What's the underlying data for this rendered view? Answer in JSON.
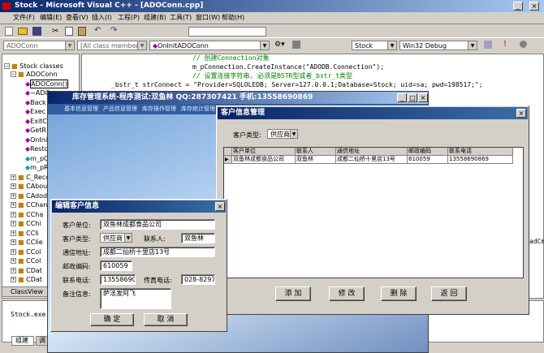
{
  "ide": {
    "title": "Stock - Microsoft Visual C++ - [ADOConn.cpp]",
    "menu": [
      "文件(F)",
      "编辑(E)",
      "查看(V)",
      "插入(I)",
      "工程(P)",
      "组建(B)",
      "工具(T)",
      "窗口(W)",
      "帮助(H)"
    ],
    "class_combo": "ADOConn",
    "members_combo": "[All class members]",
    "method_combo": "OnInitADOConn",
    "project_combo": "Stock",
    "config_combo": "Win32 Debug",
    "tree_root": "Stock classes",
    "tree_items": [
      "ADOConn",
      "ADOConn()",
      "~ADO",
      "Back",
      "Exec",
      "ExitC",
      "GetR",
      "OnIni",
      "Resto",
      "m_pC",
      "m_pR",
      "C_Recor",
      "CAboutD",
      "CAdodc",
      "CChange",
      "CCha",
      "CChi",
      "CCli",
      "CClie",
      "CCol",
      "CCol",
      "CDat",
      "CDat"
    ],
    "classview_tab": "ClassView",
    "output_text": "Stock.exe -",
    "bottom_tab": "组建",
    "bottom_tab2": "调",
    "code_lines": [
      "// 创建Connection对象",
      "m_pConnection.CreateInstance(\"ADODB.Connection\");",
      "// 设置连接字符串, 必须是BSTR型或者_bstr_t类型",
      "_bstr_t strConnect = \"Provider=SQLOLEDB; Server=127.0.0.1;Database=Stock; uid=sa; pwd=198517;\";",
      "m_pConnection->Open(strConnect,\"\",\"\",adModeUnknown);"
    ],
    "code_right_fragment": "adCm"
  },
  "app": {
    "title": "库存管理系统-程序测试:双鱼林 QQ:287307421 手机:13558690869",
    "menu": [
      "基本信息管理",
      "产品信息管理",
      "库存操作管理",
      "库存统计管理"
    ]
  },
  "customer_window": {
    "title": "客户信息管理",
    "type_label": "客户类型:",
    "type_value": "供应商",
    "grid_headers": [
      "客户单位",
      "联系人",
      "通信地址",
      "邮政编码",
      "联系电话"
    ],
    "grid_row": [
      "双鱼林成都食品公司",
      "双鱼林",
      "成都二仙桥十里店13号",
      "610059",
      "13558690869"
    ],
    "buttons": [
      "添 加",
      "修 改",
      "删 除",
      "返 回"
    ]
  },
  "edit_dialog": {
    "title": "编辑客户信息",
    "unit_label": "客户单位:",
    "unit_value": "双鱼林成都食品公司",
    "type_label": "客户类型:",
    "type_value": "供应商",
    "contact_label": "联系人:",
    "contact_value": "双鱼林",
    "address_label": "通信地址:",
    "address_value": "成都二仙桥十里店13号",
    "zip_label": "邮政编码:",
    "zip_value": "610059",
    "phone_label": "联系电话:",
    "phone_value": "13558690869",
    "fax_label": "传真电话:",
    "fax_value": "028-8297668",
    "note_label": "备注信息:",
    "note_value": "萨法发阿飞",
    "ok": "确 定",
    "cancel": "取 消"
  }
}
